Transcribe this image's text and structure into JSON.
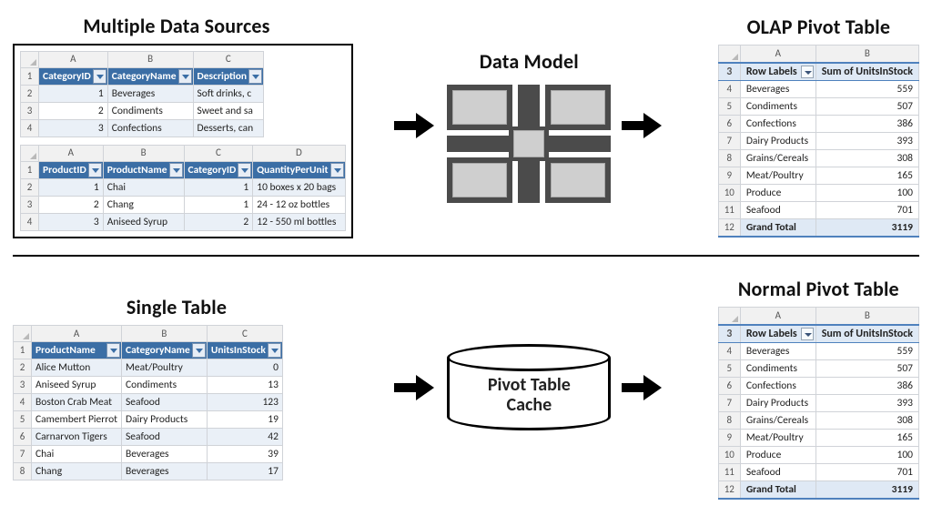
{
  "headings": {
    "multi_sources": "Multiple Data Sources",
    "data_model": "Data Model",
    "olap_pivot": "OLAP Pivot Table",
    "single_table": "Single Table",
    "normal_pivot": "Normal Pivot Table"
  },
  "cylinder": {
    "line1": "Pivot Table",
    "line2": "Cache"
  },
  "source_top1": {
    "col_letters": [
      "A",
      "B",
      "C"
    ],
    "headers": [
      "CategoryID",
      "CategoryName",
      "Description"
    ],
    "rows": [
      {
        "n": 2,
        "c": [
          "1",
          "Beverages",
          "Soft drinks, c"
        ]
      },
      {
        "n": 3,
        "c": [
          "2",
          "Condiments",
          "Sweet and sa"
        ]
      },
      {
        "n": 4,
        "c": [
          "3",
          "Confections",
          "Desserts, can"
        ]
      }
    ]
  },
  "source_top2": {
    "col_letters": [
      "A",
      "B",
      "C",
      "D"
    ],
    "headers": [
      "ProductID",
      "ProductName",
      "CategoryID",
      "QuantityPerUnit"
    ],
    "rows": [
      {
        "n": 2,
        "c": [
          "1",
          "Chai",
          "1",
          "10 boxes x 20 bags"
        ]
      },
      {
        "n": 3,
        "c": [
          "2",
          "Chang",
          "1",
          "24 - 12 oz bottles"
        ]
      },
      {
        "n": 4,
        "c": [
          "3",
          "Aniseed Syrup",
          "2",
          "12 - 550 ml bottles"
        ]
      }
    ]
  },
  "source_bottom": {
    "col_letters": [
      "A",
      "B",
      "C"
    ],
    "headers": [
      "ProductName",
      "CategoryName",
      "UnitsInStock"
    ],
    "rows": [
      {
        "n": 2,
        "c": [
          "Alice Mutton",
          "Meat/Poultry",
          "0"
        ]
      },
      {
        "n": 3,
        "c": [
          "Aniseed Syrup",
          "Condiments",
          "13"
        ]
      },
      {
        "n": 4,
        "c": [
          "Boston Crab Meat",
          "Seafood",
          "123"
        ]
      },
      {
        "n": 5,
        "c": [
          "Camembert Pierrot",
          "Dairy Products",
          "19"
        ]
      },
      {
        "n": 6,
        "c": [
          "Carnarvon Tigers",
          "Seafood",
          "42"
        ]
      },
      {
        "n": 7,
        "c": [
          "Chai",
          "Beverages",
          "39"
        ]
      },
      {
        "n": 8,
        "c": [
          "Chang",
          "Beverages",
          "17"
        ]
      }
    ]
  },
  "pivot": {
    "col_letters": [
      "A",
      "B"
    ],
    "row_labels": "Row Labels",
    "measure": "Sum of UnitsInStock",
    "rows": [
      {
        "n": 4,
        "label": "Beverages",
        "value": 559
      },
      {
        "n": 5,
        "label": "Condiments",
        "value": 507
      },
      {
        "n": 6,
        "label": "Confections",
        "value": 386
      },
      {
        "n": 7,
        "label": "Dairy Products",
        "value": 393
      },
      {
        "n": 8,
        "label": "Grains/Cereals",
        "value": 308
      },
      {
        "n": 9,
        "label": "Meat/Poultry",
        "value": 165
      },
      {
        "n": 10,
        "label": "Produce",
        "value": 100
      },
      {
        "n": 11,
        "label": "Seafood",
        "value": 701
      }
    ],
    "grand": {
      "n": 12,
      "label": "Grand Total",
      "value": 3119
    }
  },
  "chart_data": {
    "type": "table",
    "title": "Sum of UnitsInStock by Category (used for both OLAP and Normal pivot)",
    "categories": [
      "Beverages",
      "Condiments",
      "Confections",
      "Dairy Products",
      "Grains/Cereals",
      "Meat/Poultry",
      "Produce",
      "Seafood"
    ],
    "values": [
      559,
      507,
      386,
      393,
      308,
      165,
      100,
      701
    ],
    "grand_total": 3119
  }
}
